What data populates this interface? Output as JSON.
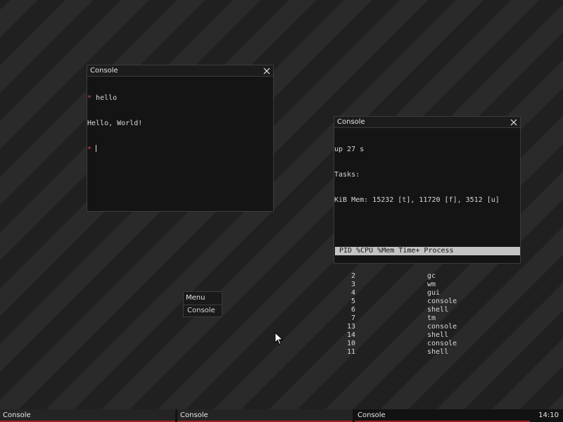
{
  "console_window_1": {
    "title": "Console",
    "close_icon": "close-icon",
    "lines": [
      {
        "prompt": "*",
        "text": " hello"
      },
      {
        "prompt": "",
        "text": "Hello, World!"
      }
    ],
    "input_prompt": "*",
    "input_value": ""
  },
  "console_window_2": {
    "title": "Console",
    "close_icon": "close-icon",
    "uptime": "up 27 s",
    "tasks_label": "Tasks:",
    "mem_line": "KiB Mem: 15232 [t], 11720 [f], 3512 [u]",
    "table_header": " PID %CPU %Mem Time+ Process",
    "processes": [
      {
        "pid": "2",
        "name": "gc"
      },
      {
        "pid": "3",
        "name": "wm"
      },
      {
        "pid": "4",
        "name": "gui"
      },
      {
        "pid": "5",
        "name": "console"
      },
      {
        "pid": "6",
        "name": "shell"
      },
      {
        "pid": "7",
        "name": "tm"
      },
      {
        "pid": "13",
        "name": "console"
      },
      {
        "pid": "14",
        "name": "shell"
      },
      {
        "pid": "10",
        "name": "console"
      },
      {
        "pid": "11",
        "name": "shell"
      }
    ]
  },
  "menu": {
    "title": "Menu",
    "items": [
      "Console"
    ]
  },
  "taskbar": {
    "buttons": [
      "Console",
      "Console",
      "Console"
    ],
    "active_index": 2,
    "clock": "14:10"
  },
  "colors": {
    "accent": "#a02222",
    "prompt": "#e04444",
    "window_bg": "#141414",
    "desktop_stripe_light": "#2a2a2a",
    "desktop_stripe_dark": "#202020"
  }
}
